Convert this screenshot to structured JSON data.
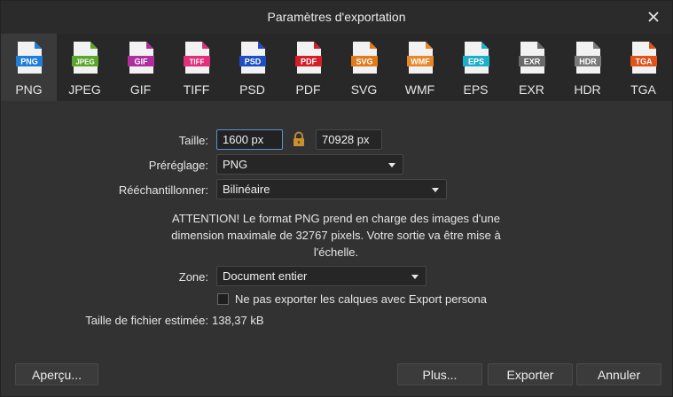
{
  "window": {
    "title": "Paramètres d'exportation"
  },
  "formats": [
    {
      "label": "PNG",
      "icon_text": "PNG",
      "color": "#1f7fd6",
      "selected": true
    },
    {
      "label": "JPEG",
      "icon_text": "JPEG",
      "color": "#5aa62c",
      "selected": false
    },
    {
      "label": "GIF",
      "icon_text": "GIF",
      "color": "#b02fa0",
      "selected": false
    },
    {
      "label": "TIFF",
      "icon_text": "TIFF",
      "color": "#e0307a",
      "selected": false
    },
    {
      "label": "PSD",
      "icon_text": "PSD",
      "color": "#1d4fc2",
      "selected": false
    },
    {
      "label": "PDF",
      "icon_text": "PDF",
      "color": "#d41f2a",
      "selected": false
    },
    {
      "label": "SVG",
      "icon_text": "SVG",
      "color": "#e07a1a",
      "selected": false
    },
    {
      "label": "WMF",
      "icon_text": "WMF",
      "color": "#e8862a",
      "selected": false
    },
    {
      "label": "EPS",
      "icon_text": "EPS",
      "color": "#1eaec8",
      "selected": false
    },
    {
      "label": "EXR",
      "icon_text": "EXR",
      "color": "#6a6a6a",
      "selected": false
    },
    {
      "label": "HDR",
      "icon_text": "HDR",
      "color": "#7a7a7a",
      "selected": false
    },
    {
      "label": "TGA",
      "icon_text": "TGA",
      "color": "#e0541a",
      "selected": false
    }
  ],
  "form": {
    "size_label": "Taille:",
    "width_value": "1600 px",
    "height_value": "70928 px",
    "preset_label": "Préréglage:",
    "preset_value": "PNG",
    "resample_label": "Rééchantillonner:",
    "resample_value": "Bilinéaire",
    "warning": "ATTENTION! Le format PNG prend en charge des images d'une dimension maximale de 32767 pixels. Votre sortie va être mise à l'échelle.",
    "zone_label": "Zone:",
    "zone_value": "Document entier",
    "checkbox_label": "Ne pas exporter les calques avec Export persona",
    "checkbox_checked": false,
    "filesize_label": "Taille de fichier estimée:",
    "filesize_value": "138,37 kB"
  },
  "buttons": {
    "preview": "Aperçu...",
    "more": "Plus...",
    "export": "Exporter",
    "cancel": "Annuler"
  }
}
